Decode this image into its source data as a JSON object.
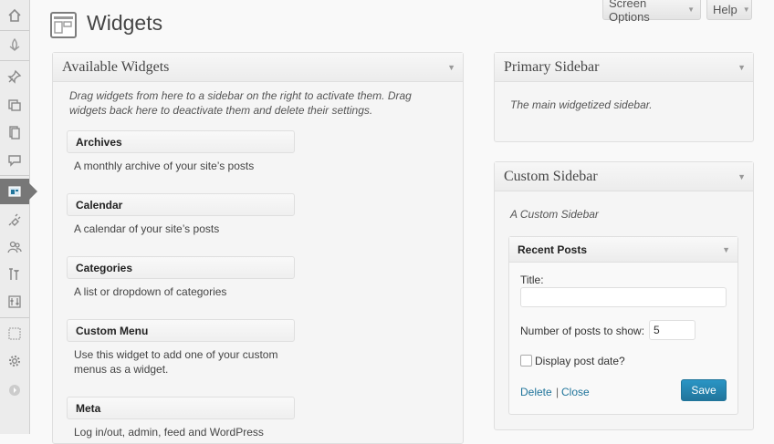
{
  "admin_menu": {
    "items": [
      {
        "icon": "dashboard-icon"
      },
      {
        "icon": "jetpack-icon"
      },
      {
        "icon": "posts-pin-icon"
      },
      {
        "icon": "media-icon"
      },
      {
        "icon": "pages-icon"
      },
      {
        "icon": "comments-icon"
      },
      {
        "icon": "appearance-icon",
        "active": true
      },
      {
        "icon": "plugins-icon"
      },
      {
        "icon": "users-icon"
      },
      {
        "icon": "tools-icon"
      },
      {
        "icon": "settings-sliders-icon"
      },
      {
        "icon": "layout-icon"
      },
      {
        "icon": "settings-gear-icon"
      },
      {
        "icon": "collapse-menu-icon"
      }
    ]
  },
  "header": {
    "title": "Widgets",
    "screen_options_label": "Screen Options",
    "help_label": "Help"
  },
  "available": {
    "title": "Available Widgets",
    "description": "Drag widgets from here to a sidebar on the right to activate them. Drag widgets back here to deactivate them and delete their settings.",
    "widgets": [
      {
        "title": "Archives",
        "desc": "A monthly archive of your site’s posts"
      },
      {
        "title": "Calendar",
        "desc": "A calendar of your site’s posts"
      },
      {
        "title": "Categories",
        "desc": "A list or dropdown of categories"
      },
      {
        "title": "Custom Menu",
        "desc": "Use this widget to add one of your custom menus as a widget."
      },
      {
        "title": "Meta",
        "desc": "Log in/out, admin, feed and WordPress"
      }
    ]
  },
  "primary_sidebar": {
    "title": "Primary Sidebar",
    "description": "The main widgetized sidebar."
  },
  "custom_sidebar": {
    "title": "Custom Sidebar",
    "description": "A Custom Sidebar",
    "widget": {
      "title": "Recent Posts",
      "title_label": "Title:",
      "title_value": "",
      "number_label": "Number of posts to show:",
      "number_value": "5",
      "display_date_label": "Display post date?",
      "display_date_checked": false,
      "delete_label": "Delete",
      "separator": "|",
      "close_label": "Close",
      "save_label": "Save"
    }
  },
  "colors": {
    "accent": "#21759b",
    "menu_active": "#777777"
  }
}
